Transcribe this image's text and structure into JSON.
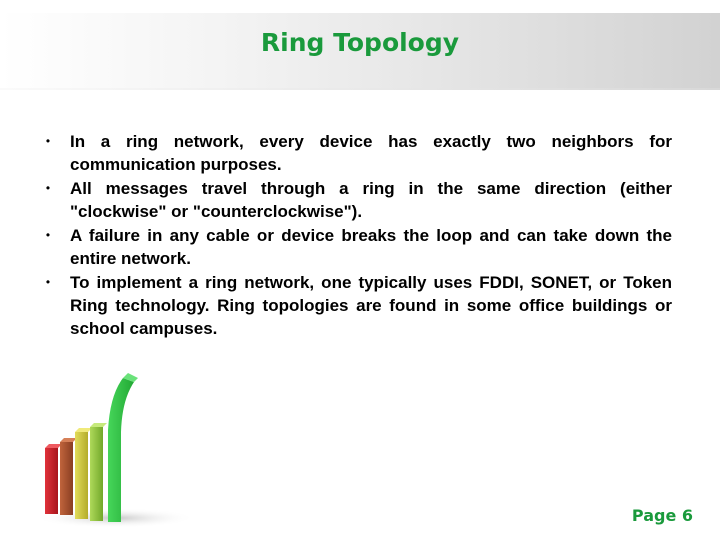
{
  "slide": {
    "title": "Ring Topology",
    "bullets": [
      {
        "text": "In a ring network, every device has exactly two neighbors for communication purposes."
      },
      {
        "text": "All messages travel through a ring in the same direction (either \"clockwise\" or \"counterclockwise\")."
      },
      {
        "text": "A failure in any cable or device breaks the loop and can take down the entire network."
      },
      {
        "text": "To implement a ring network, one typically uses FDDI, SONET, or Token Ring technology. Ring topologies are found in some office buildings or school campuses."
      }
    ],
    "bullet_glyph": "•",
    "page_label": "Page 6",
    "decoration": {
      "icon": "rising-bar-chart-icon",
      "bar_colors": [
        "#c8202a",
        "#a8502e",
        "#c9c23a",
        "#8fc23a",
        "#2fbf3f"
      ]
    },
    "colors": {
      "accent": "#1a9a3c",
      "text": "#000000"
    }
  }
}
